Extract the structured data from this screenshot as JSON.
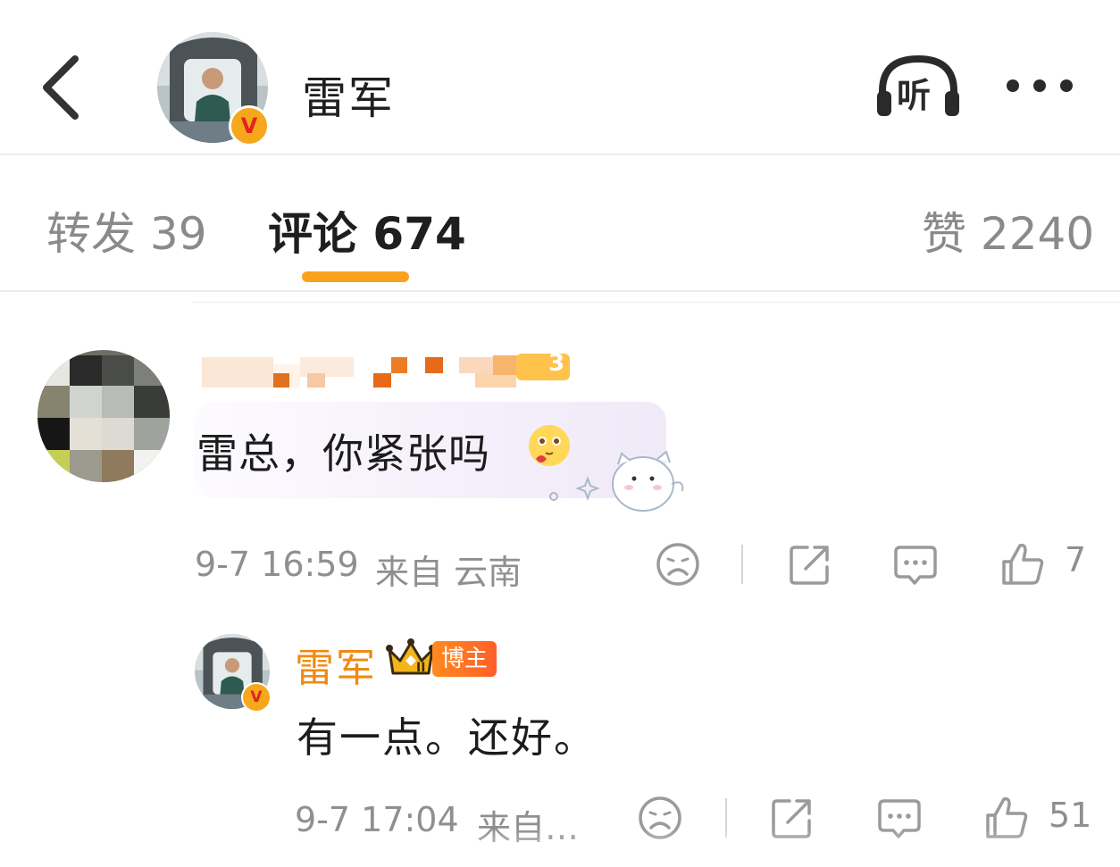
{
  "header": {
    "title": "雷军",
    "listen_label": "听"
  },
  "tabs": {
    "repost": "转发 39",
    "comment": "评论 674",
    "like": "赞 2240"
  },
  "comments": [
    {
      "user_level_badge": "3",
      "text": "雷总，你紧张吗",
      "time": "9-7 16:59",
      "location": "来自 云南",
      "likes": "7"
    },
    {
      "username": "雷军",
      "role_badge": "博主",
      "crown_level": "II",
      "text": "有一点。还好。",
      "time": "9-7 17:04",
      "location": "来自…",
      "likes": "51"
    }
  ],
  "verified_badge": "V",
  "colors": {
    "accent": "#f9a21e",
    "verified_badge": "#f7a71c",
    "blogger_name": "#f08a12",
    "meta_text": "#8f8f8f"
  },
  "icons": [
    "back-arrow-icon",
    "listen-headphones-icon",
    "more-dots-icon",
    "dislike-face-icon",
    "share-icon",
    "reply-icon",
    "thumbs-up-icon",
    "crown-icon",
    "verified-v-icon"
  ]
}
